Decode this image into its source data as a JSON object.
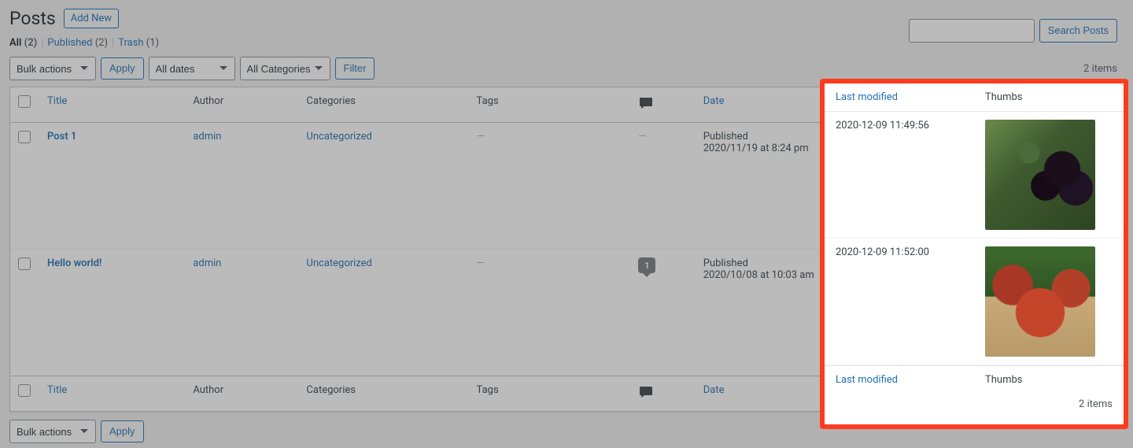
{
  "header": {
    "title": "Posts",
    "add_new": "Add New"
  },
  "filters": {
    "all_label": "All",
    "all_count": "(2)",
    "published_label": "Published",
    "published_count": "(2)",
    "trash_label": "Trash",
    "trash_count": "(1)"
  },
  "toolbar": {
    "bulk_actions": "Bulk actions",
    "apply": "Apply",
    "all_dates": "All dates",
    "all_categories": "All Categories",
    "filter": "Filter",
    "items_count": "2 items",
    "search_placeholder": "",
    "search_button": "Search Posts"
  },
  "columns": {
    "title": "Title",
    "author": "Author",
    "categories": "Categories",
    "tags": "Tags",
    "date": "Date",
    "last_modified": "Last modified",
    "thumbs": "Thumbs"
  },
  "rows": [
    {
      "title": "Post 1",
      "author": "admin",
      "category": "Uncategorized",
      "tags": "—",
      "comments": "—",
      "date_status": "Published",
      "date_value": "2020/11/19 at 8:24 pm",
      "modified": "2020-12-09 11:49:56",
      "thumb_class": "thumb-berries",
      "thumb_name": "thumb-post-1"
    },
    {
      "title": "Hello world!",
      "author": "admin",
      "category": "Uncategorized",
      "tags": "—",
      "comments": "1",
      "date_status": "Published",
      "date_value": "2020/10/08 at 10:03 am",
      "modified": "2020-12-09 11:52:00",
      "thumb_class": "thumb-apples",
      "thumb_name": "thumb-post-2"
    }
  ],
  "bottom": {
    "items_count": "2 items"
  }
}
